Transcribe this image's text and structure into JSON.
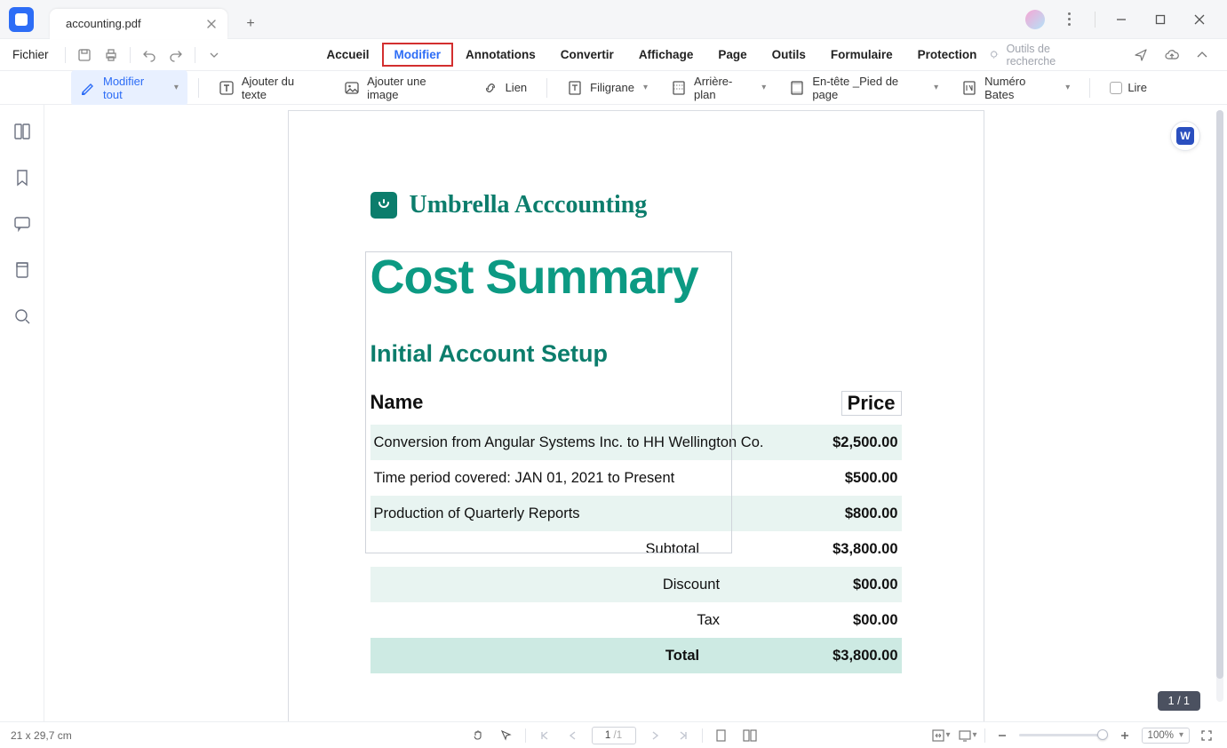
{
  "tab": {
    "title": "accounting.pdf"
  },
  "file_menu_label": "Fichier",
  "menu": {
    "items": [
      "Accueil",
      "Modifier",
      "Annotations",
      "Convertir",
      "Affichage",
      "Page",
      "Outils",
      "Formulaire",
      "Protection"
    ],
    "active_index": 1,
    "search_hint": "Outils de recherche"
  },
  "toolbar": {
    "modify_all": "Modifier tout",
    "add_text": "Ajouter du texte",
    "add_image": "Ajouter une image",
    "link": "Lien",
    "watermark": "Filigrane",
    "background": "Arrière-plan",
    "header_footer": "En-tête _Pied de page",
    "bates": "Numéro Bates",
    "read_mode": "Lire"
  },
  "doc": {
    "company": "Umbrella Acccounting",
    "title": "Cost Summary",
    "subtitle": "Initial Account Setup",
    "col_name": "Name",
    "col_price": "Price",
    "rows": [
      {
        "label": "Conversion from Angular Systems Inc. to HH Wellington Co.",
        "price": "$2,500.00"
      },
      {
        "label": "Time period covered: JAN 01, 2021 to Present",
        "price": "$500.00"
      },
      {
        "label": "Production of Quarterly Reports",
        "price": "$800.00"
      }
    ],
    "subtotal_label": "Subtotal",
    "subtotal": "$3,800.00",
    "discount_label": "Discount",
    "discount": "$00.00",
    "tax_label": "Tax",
    "tax": "$00.00",
    "total_label": "Total",
    "total": "$3,800.00"
  },
  "page_indicator": "1 / 1",
  "status": {
    "dimensions": "21 x 29,7 cm",
    "page_current": "1",
    "page_total": "/1",
    "zoom": "100%"
  }
}
